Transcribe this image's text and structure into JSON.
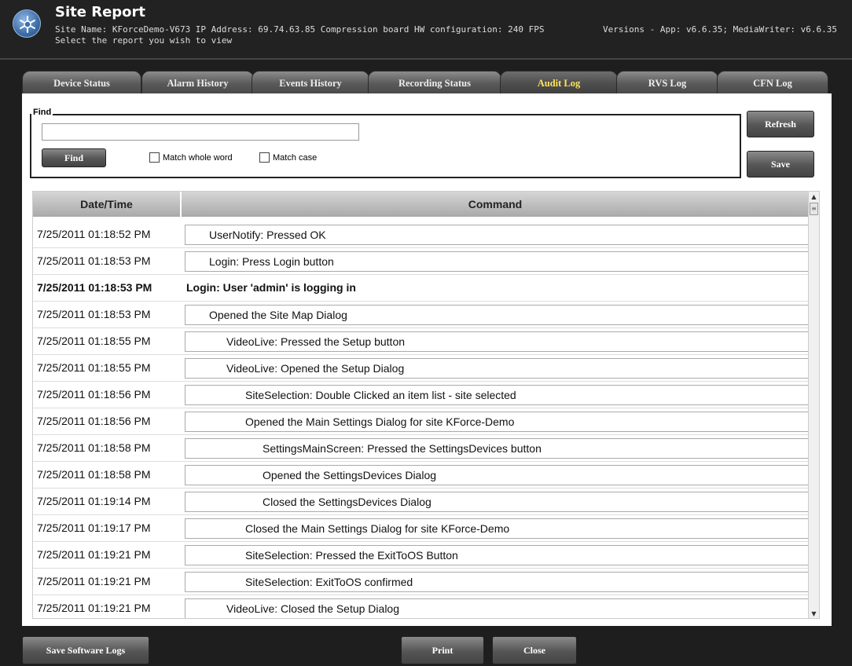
{
  "header": {
    "title": "Site Report",
    "site_info": "Site Name: KForceDemo-V673  IP Address: 69.74.63.85  Compression board HW configuration: 240 FPS",
    "versions": "Versions - App: v6.6.35; MediaWriter: v6.6.35",
    "subtitle": "Select the report you wish to view"
  },
  "tabs": [
    {
      "label": "Device Status"
    },
    {
      "label": "Alarm History"
    },
    {
      "label": "Events History"
    },
    {
      "label": "Recording Status"
    },
    {
      "label": "Audit Log",
      "active": true
    },
    {
      "label": "RVS Log"
    },
    {
      "label": "CFN Log"
    }
  ],
  "find": {
    "legend": "Find",
    "input_value": "",
    "find_button": "Find",
    "match_whole_word": "Match whole word",
    "match_case": "Match case"
  },
  "actions": {
    "refresh": "Refresh",
    "save": "Save"
  },
  "table": {
    "headers": {
      "datetime": "Date/Time",
      "command": "Command"
    },
    "rows": [
      {
        "datetime": "7/25/2011 01:18:52 PM",
        "command": "UserNotify: Pressed OK"
      },
      {
        "datetime": "7/25/2011 01:18:53 PM",
        "command": "Login: Press Login button"
      },
      {
        "datetime": "7/25/2011 01:18:53 PM",
        "command": "Login: User 'admin' is logging in"
      },
      {
        "datetime": "7/25/2011 01:18:53 PM",
        "command": "Opened the Site Map Dialog"
      },
      {
        "datetime": "7/25/2011 01:18:55 PM",
        "command": "VideoLive: Pressed the Setup button"
      },
      {
        "datetime": "7/25/2011 01:18:55 PM",
        "command": "VideoLive: Opened the Setup Dialog"
      },
      {
        "datetime": "7/25/2011 01:18:56 PM",
        "command": "SiteSelection: Double Clicked an item list - site selected"
      },
      {
        "datetime": "7/25/2011 01:18:56 PM",
        "command": "Opened the Main Settings Dialog for site KForce-Demo"
      },
      {
        "datetime": "7/25/2011 01:18:58 PM",
        "command": "SettingsMainScreen: Pressed the SettingsDevices button"
      },
      {
        "datetime": "7/25/2011 01:18:58 PM",
        "command": "Opened the SettingsDevices Dialog"
      },
      {
        "datetime": "7/25/2011 01:19:14 PM",
        "command": "Closed the SettingsDevices Dialog"
      },
      {
        "datetime": "7/25/2011 01:19:17 PM",
        "command": "Closed the Main Settings Dialog for site KForce-Demo"
      },
      {
        "datetime": "7/25/2011 01:19:21 PM",
        "command": "SiteSelection: Pressed the ExitToOS Button"
      },
      {
        "datetime": "7/25/2011 01:19:21 PM",
        "command": "SiteSelection: ExitToOS confirmed"
      },
      {
        "datetime": "7/25/2011 01:19:21 PM",
        "command": "VideoLive: Closed the Setup Dialog"
      }
    ]
  },
  "footer": {
    "save_software_logs": "Save Software Logs",
    "print": "Print",
    "close": "Close"
  },
  "colors": {
    "background": "#1e1e1e",
    "active_tab_text": "#ffe45c",
    "tab_text": "#eeeeee"
  }
}
